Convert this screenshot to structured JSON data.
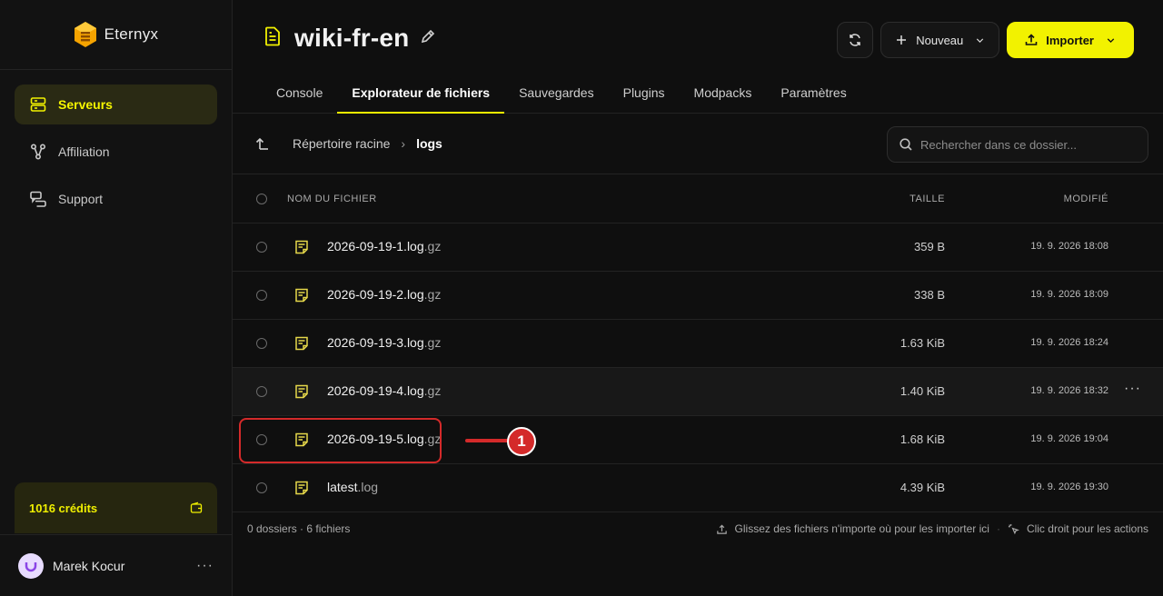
{
  "brand": {
    "name": "Eternyx"
  },
  "sidebar": {
    "items": [
      {
        "label": "Serveurs",
        "icon": "server-icon",
        "active": true
      },
      {
        "label": "Affiliation",
        "icon": "network-icon",
        "active": false
      },
      {
        "label": "Support",
        "icon": "chat-icon",
        "active": false
      }
    ],
    "credits": "1016 crédits",
    "user": {
      "name": "Marek Kocur",
      "menu": "···"
    }
  },
  "header": {
    "title": "wiki-fr-en",
    "new_label": "Nouveau",
    "import_label": "Importer",
    "tabs": [
      {
        "label": "Console"
      },
      {
        "label": "Explorateur de fichiers"
      },
      {
        "label": "Sauvegardes"
      },
      {
        "label": "Plugins"
      },
      {
        "label": "Modpacks"
      },
      {
        "label": "Paramètres"
      }
    ]
  },
  "toolbar": {
    "root": "Répertoire racine",
    "separator": "›",
    "current": "logs",
    "search_placeholder": "Rechercher dans ce dossier..."
  },
  "table": {
    "headers": {
      "name": "NOM DU FICHIER",
      "size": "TAILLE",
      "modified": "MODIFIÉ"
    },
    "rows": [
      {
        "base": "2026-09-19-1.log",
        "ext": ".gz",
        "size": "359 B",
        "modified": "19. 9. 2026 18:08"
      },
      {
        "base": "2026-09-19-2.log",
        "ext": ".gz",
        "size": "338 B",
        "modified": "19. 9. 2026 18:09"
      },
      {
        "base": "2026-09-19-3.log",
        "ext": ".gz",
        "size": "1.63 KiB",
        "modified": "19. 9. 2026 18:24"
      },
      {
        "base": "2026-09-19-4.log",
        "ext": ".gz",
        "size": "1.40 KiB",
        "modified": "19. 9. 2026 18:32",
        "menu": "···"
      },
      {
        "base": "2026-09-19-5.log",
        "ext": ".gz",
        "size": "1.68 KiB",
        "modified": "19. 9. 2026 19:04"
      },
      {
        "base": "latest",
        "ext": ".log",
        "size": "4.39 KiB",
        "modified": "19. 9. 2026 19:30"
      }
    ]
  },
  "footer": {
    "counts": "0 dossiers · 6 fichiers",
    "drop_hint": "Glissez des fichiers n'importe où pour les importer ici",
    "separator": "·",
    "context_hint": "Clic droit pour les actions"
  },
  "annotation": {
    "badge": "1",
    "color": "#d42a2a"
  },
  "colors": {
    "accent": "#f2f200",
    "background": "#0f0f0f",
    "file_icon": "#e6d84a"
  }
}
